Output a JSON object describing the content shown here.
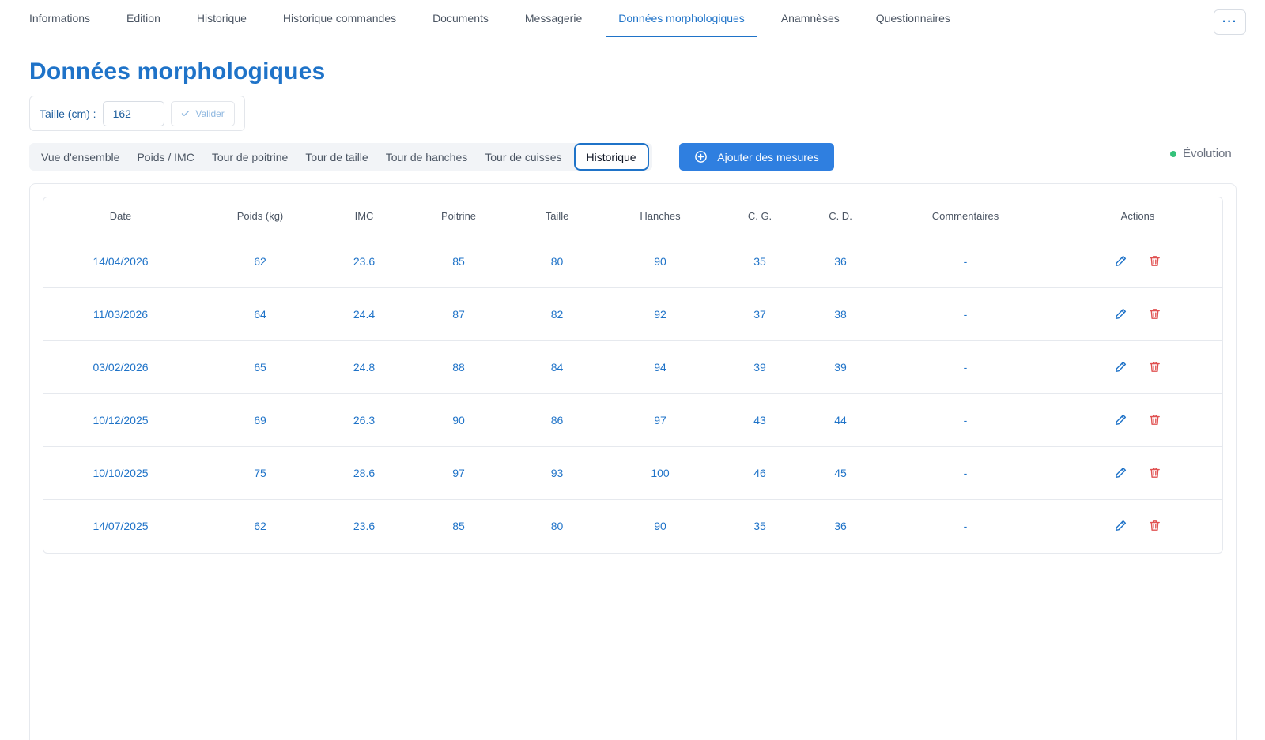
{
  "top_tabs": [
    {
      "label": "Informations"
    },
    {
      "label": "Édition"
    },
    {
      "label": "Historique"
    },
    {
      "label": "Historique commandes"
    },
    {
      "label": "Documents"
    },
    {
      "label": "Messagerie"
    },
    {
      "label": "Données morphologiques",
      "active": true
    },
    {
      "label": "Anamnèses"
    },
    {
      "label": "Questionnaires"
    }
  ],
  "more_button": {
    "label": "···",
    "icon": "more-horizontal-icon"
  },
  "page_title": "Données morphologiques",
  "height": {
    "label": "Taille (cm) :",
    "value": "162",
    "validate_label": "Valider",
    "validate_icon": "check-icon"
  },
  "sub_tabs": [
    {
      "label": "Vue d'ensemble"
    },
    {
      "label": "Poids / IMC"
    },
    {
      "label": "Tour de poitrine"
    },
    {
      "label": "Tour de taille"
    },
    {
      "label": "Tour de hanches"
    },
    {
      "label": "Tour de cuisses"
    },
    {
      "label": "Historique",
      "active": true
    }
  ],
  "add_button": {
    "label": "Ajouter des mesures",
    "icon": "plus-circle-icon"
  },
  "evolution": {
    "label": "Évolution",
    "dot_color": "#34c27a"
  },
  "table": {
    "headers": [
      "Date",
      "Poids (kg)",
      "IMC",
      "Poitrine",
      "Taille",
      "Hanches",
      "C. G.",
      "C. D.",
      "Commentaires",
      "Actions"
    ],
    "rows": [
      [
        "14/04/2026",
        "62",
        "23.6",
        "85",
        "80",
        "90",
        "35",
        "36",
        "-"
      ],
      [
        "11/03/2026",
        "64",
        "24.4",
        "87",
        "82",
        "92",
        "37",
        "38",
        "-"
      ],
      [
        "03/02/2026",
        "65",
        "24.8",
        "88",
        "84",
        "94",
        "39",
        "39",
        "-"
      ],
      [
        "10/12/2025",
        "69",
        "26.3",
        "90",
        "86",
        "97",
        "43",
        "44",
        "-"
      ],
      [
        "10/10/2025",
        "75",
        "28.6",
        "97",
        "93",
        "100",
        "46",
        "45",
        "-"
      ],
      [
        "14/07/2025",
        "62",
        "23.6",
        "85",
        "80",
        "90",
        "35",
        "36",
        "-"
      ]
    ],
    "action_icons": [
      "pencil-icon",
      "trash-icon"
    ]
  },
  "colors": {
    "accent": "#1f73c8",
    "button": "#2f7fe0",
    "delete": "#e05252",
    "success": "#34c27a"
  }
}
